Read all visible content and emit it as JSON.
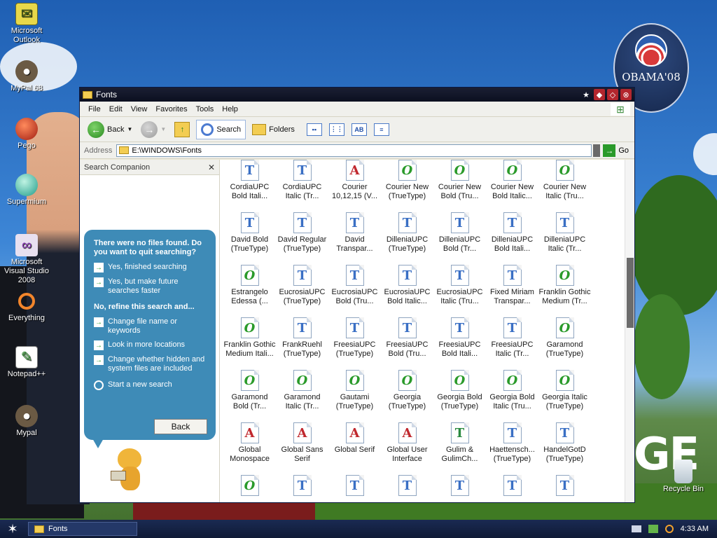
{
  "desktop": {
    "icons": [
      {
        "label": "Microsoft Outlook",
        "icon": "outlook-icon"
      },
      {
        "label": "MyPal 68",
        "icon": "mypal-icon"
      },
      {
        "label": "Pego",
        "icon": "pego-icon"
      },
      {
        "label": "Supermium",
        "icon": "supermium-icon"
      },
      {
        "label": "Microsoft Visual Studio 2008",
        "icon": "visual-studio-icon"
      },
      {
        "label": "Everything",
        "icon": "everything-icon"
      },
      {
        "label": "Notepad++",
        "icon": "notepad-icon"
      },
      {
        "label": "Mypal",
        "icon": "mypal-icon"
      }
    ],
    "recycle_bin": "Recycle Bin",
    "badge_text": "OBAMA'08",
    "background_word": "GE"
  },
  "window": {
    "title": "Fonts",
    "menu": [
      "File",
      "Edit",
      "View",
      "Favorites",
      "Tools",
      "Help"
    ],
    "toolbar": {
      "back": "Back",
      "search": "Search",
      "folders": "Folders"
    },
    "address": {
      "label": "Address",
      "path": "E:\\WINDOWS\\Fonts",
      "go": "Go"
    }
  },
  "companion": {
    "title": "Search Companion",
    "question": "There were no files found. Do you want to quit searching?",
    "options_quit": [
      "Yes, finished searching",
      "Yes, but make future searches faster"
    ],
    "refine_heading": "No, refine this search and...",
    "options_refine": [
      "Change file name or keywords",
      "Look in more locations",
      "Change whether hidden and system files are included"
    ],
    "new_search": "Start a new search",
    "back_button": "Back"
  },
  "files": [
    {
      "name": "CordiaUPC Bold Itali...",
      "type": "T"
    },
    {
      "name": "CordiaUPC Italic (Tr...",
      "type": "T"
    },
    {
      "name": "Courier 10,12,15 (V...",
      "type": "A"
    },
    {
      "name": "Courier New (TrueType)",
      "type": "O"
    },
    {
      "name": "Courier New Bold (Tru...",
      "type": "O"
    },
    {
      "name": "Courier New Bold Italic...",
      "type": "O"
    },
    {
      "name": "Courier New Italic (Tru...",
      "type": "O"
    },
    {
      "name": "David Bold (TrueType)",
      "type": "T"
    },
    {
      "name": "David Regular (TrueType)",
      "type": "T"
    },
    {
      "name": "David Transpar...",
      "type": "T"
    },
    {
      "name": "DilleniaUPC (TrueType)",
      "type": "T"
    },
    {
      "name": "DilleniaUPC Bold (Tr...",
      "type": "T"
    },
    {
      "name": "DilleniaUPC Bold Itali...",
      "type": "T"
    },
    {
      "name": "DilleniaUPC Italic (Tr...",
      "type": "T"
    },
    {
      "name": "Estrangelo Edessa (...",
      "type": "O"
    },
    {
      "name": "EucrosiaUPC (TrueType)",
      "type": "T"
    },
    {
      "name": "EucrosiaUPC Bold (Tru...",
      "type": "T"
    },
    {
      "name": "EucrosiaUPC Bold Italic...",
      "type": "T"
    },
    {
      "name": "EucrosiaUPC Italic (Tru...",
      "type": "T"
    },
    {
      "name": "Fixed Miriam Transpar...",
      "type": "T"
    },
    {
      "name": "Franklin Gothic Medium (Tr...",
      "type": "O"
    },
    {
      "name": "Franklin Gothic Medium Itali...",
      "type": "O"
    },
    {
      "name": "FrankRuehl (TrueType)",
      "type": "T"
    },
    {
      "name": "FreesiaUPC (TrueType)",
      "type": "T"
    },
    {
      "name": "FreesiaUPC Bold (Tru...",
      "type": "T"
    },
    {
      "name": "FreesiaUPC Bold Itali...",
      "type": "T"
    },
    {
      "name": "FreesiaUPC Italic (Tr...",
      "type": "T"
    },
    {
      "name": "Garamond (TrueType)",
      "type": "O"
    },
    {
      "name": "Garamond Bold (Tr...",
      "type": "O"
    },
    {
      "name": "Garamond Italic (Tr...",
      "type": "O"
    },
    {
      "name": "Gautami (TrueType)",
      "type": "O"
    },
    {
      "name": "Georgia (TrueType)",
      "type": "O"
    },
    {
      "name": "Georgia Bold (TrueType)",
      "type": "O"
    },
    {
      "name": "Georgia Bold Italic (Tru...",
      "type": "O"
    },
    {
      "name": "Georgia Italic (TrueType)",
      "type": "O"
    },
    {
      "name": "Global Monospace",
      "type": "A"
    },
    {
      "name": "Global Sans Serif",
      "type": "A"
    },
    {
      "name": "Global Serif",
      "type": "A"
    },
    {
      "name": "Global User Interface",
      "type": "A"
    },
    {
      "name": "Gulim & GulimCh...",
      "type": "Tg"
    },
    {
      "name": "Haettensch... (TrueType)",
      "type": "T"
    },
    {
      "name": "HandelGotD (TrueType)",
      "type": "T"
    },
    {
      "name": "",
      "type": "O"
    },
    {
      "name": "",
      "type": "T"
    },
    {
      "name": "",
      "type": "T"
    },
    {
      "name": "",
      "type": "T"
    },
    {
      "name": "",
      "type": "T"
    },
    {
      "name": "",
      "type": "T"
    },
    {
      "name": "",
      "type": "T"
    }
  ],
  "taskbar": {
    "task": "Fonts",
    "time": "4:33 AM"
  }
}
